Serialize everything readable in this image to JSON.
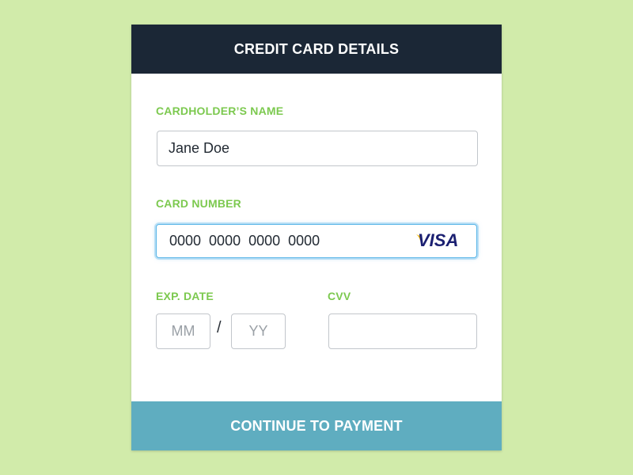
{
  "form": {
    "title": "CREDIT CARD DETAILS",
    "name": {
      "label": "CARDHOLDER’S NAME",
      "value": "Jane Doe"
    },
    "card_number": {
      "label": "CARD NUMBER",
      "value": "0000  0000  0000  0000",
      "brand_icon": "visa-logo-icon",
      "brand_text": "VISA"
    },
    "exp": {
      "label": "EXP. DATE",
      "month_placeholder": "MM",
      "year_placeholder": "YY",
      "separator": "/"
    },
    "cvv": {
      "label": "CVV",
      "value": ""
    },
    "submit_label": "CONTINUE TO PAYMENT"
  },
  "colors": {
    "background": "#d1ebaa",
    "header": "#1b2736",
    "label": "#7cc94f",
    "button": "#5fadc0",
    "focus": "#5cb7e8",
    "visa_blue": "#1a1f71",
    "visa_gold": "#f7b600"
  }
}
